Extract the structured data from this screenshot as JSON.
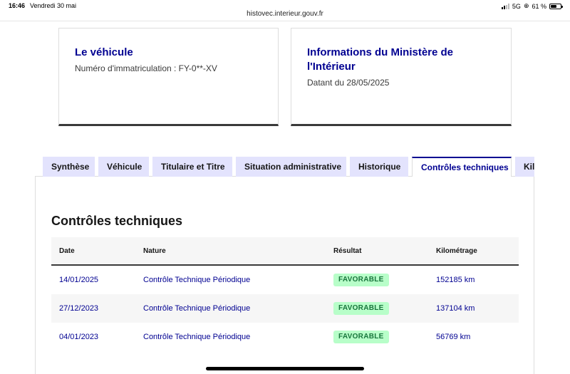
{
  "status_bar": {
    "time": "16:46",
    "date": "Vendredi 30 mai",
    "url": "histovec.interieur.gouv.fr",
    "network": "5G",
    "battery": "61 %"
  },
  "cards": {
    "vehicle": {
      "title": "Le véhicule",
      "text": "Numéro d'immatriculation : FY-0**-XV"
    },
    "ministry": {
      "title": "Informations du Ministère de l'Intérieur",
      "text": "Datant du 28/05/2025"
    }
  },
  "tabs": [
    {
      "label": "Synthèse",
      "active": false
    },
    {
      "label": "Véhicule",
      "active": false
    },
    {
      "label": "Titulaire et Titre",
      "active": false
    },
    {
      "label": "Situation administrative",
      "active": false
    },
    {
      "label": "Historique",
      "active": false
    },
    {
      "label": "Contrôles techniques",
      "active": true
    },
    {
      "label": "Kilométrage",
      "active": false
    }
  ],
  "section": {
    "title": "Contrôles techniques"
  },
  "table": {
    "headers": [
      "Date",
      "Nature",
      "Résultat",
      "Kilométrage"
    ],
    "rows": [
      {
        "date": "14/01/2025",
        "nature": "Contrôle Technique Périodique",
        "result": "FAVORABLE",
        "km": "152185 km"
      },
      {
        "date": "27/12/2023",
        "nature": "Contrôle Technique Périodique",
        "result": "FAVORABLE",
        "km": "137104 km"
      },
      {
        "date": "04/01/2023",
        "nature": "Contrôle Technique Périodique",
        "result": "FAVORABLE",
        "km": "56769 km"
      }
    ]
  },
  "colors": {
    "primary": "#000091",
    "tab_bg": "#e3e3fd",
    "badge_bg": "#b8fec9",
    "badge_text": "#18753c"
  }
}
